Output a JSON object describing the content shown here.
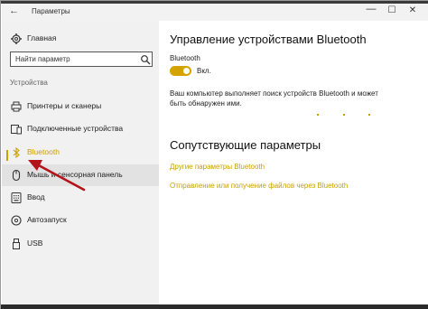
{
  "window": {
    "title": "Параметры",
    "back_glyph": "←",
    "minimize_glyph": "—",
    "maximize_glyph": "☐",
    "close_glyph": "✕"
  },
  "sidebar": {
    "home_label": "Главная",
    "search_placeholder": "Найти параметр",
    "section_label": "Устройства",
    "items": [
      {
        "label": "Принтеры и сканеры",
        "icon": "printer-icon"
      },
      {
        "label": "Подключенные устройства",
        "icon": "connected-devices-icon"
      },
      {
        "label": "Bluetooth",
        "icon": "bluetooth-icon"
      },
      {
        "label": "Мышь и сенсорная панель",
        "icon": "mouse-icon"
      },
      {
        "label": "Ввод",
        "icon": "keyboard-icon"
      },
      {
        "label": "Автозапуск",
        "icon": "autoplay-icon"
      },
      {
        "label": "USB",
        "icon": "usb-icon"
      }
    ]
  },
  "main": {
    "heading": "Управление устройствами Bluetooth",
    "bluetooth_label": "Bluetooth",
    "toggle_state": "Вкл.",
    "toggle_on": true,
    "description": "Ваш компьютер выполняет поиск устройств Bluetooth и может быть обнаружен ими.",
    "related_heading": "Сопутствующие параметры",
    "links": [
      "Другие параметры Bluetooth",
      "Отправление или получение файлов через Bluetooth"
    ]
  },
  "colors": {
    "accent": "#c8a000",
    "sidebar_bg": "#f1f1f1",
    "arrow": "#b3141a"
  }
}
